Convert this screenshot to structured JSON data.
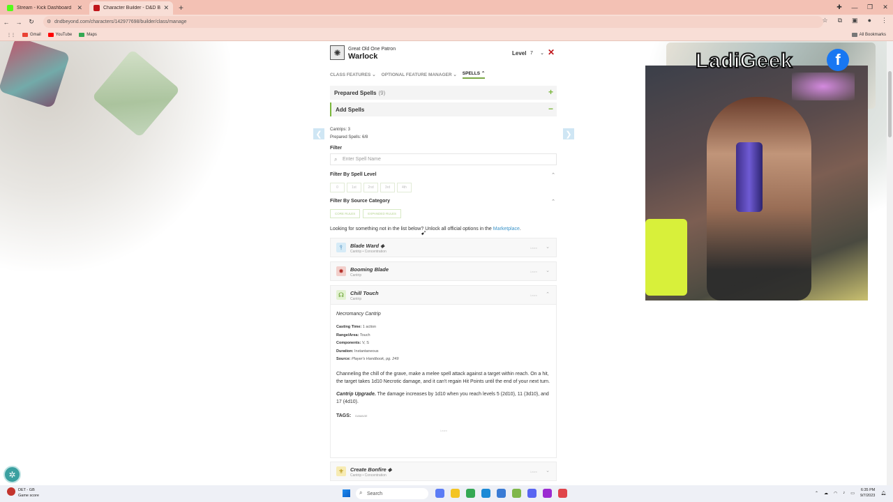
{
  "browser": {
    "tabs": [
      {
        "title": "Stream - Kick Dashboard",
        "favicon_color": "#53fc18",
        "active": false
      },
      {
        "title": "Character Builder - D&D Beyond",
        "favicon_color": "#c0161b",
        "active": true
      }
    ],
    "new_tab": "+",
    "url": "dndbeyond.com/characters/142977698/builder/class/manage",
    "bookmarks": [
      {
        "label": "Gmail",
        "color": "#ea4335"
      },
      {
        "label": "YouTube",
        "color": "#ff0000"
      },
      {
        "label": "Maps",
        "color": "#34a853"
      }
    ],
    "all_bookmarks": "All Bookmarks"
  },
  "builder": {
    "class_subtitle": "Great Old One Patron",
    "class_name": "Warlock",
    "level_label": "Level",
    "level_value": "7",
    "tabs": {
      "class_features": "CLASS FEATURES",
      "optional_feature_manager": "OPTIONAL FEATURE MANAGER",
      "spells": "SPELLS"
    },
    "prepared_spells": {
      "label": "Prepared Spells",
      "count": "(9)"
    },
    "add_spells": {
      "label": "Add Spells"
    },
    "cantrips": "Cantrips: 3",
    "prepared_count": "Prepared Spells: 6/8",
    "filter_label": "Filter",
    "search_placeholder": "Enter Spell Name",
    "filter_level_label": "Filter By Spell Level",
    "levels": [
      "0",
      "1st",
      "2nd",
      "3rd",
      "4th"
    ],
    "filter_source_label": "Filter By Source Category",
    "sources": [
      "CORE RULES",
      "EXPANDED RULES"
    ],
    "promo_text": "Looking for something not in the list below? Unlock all official options in the",
    "promo_link": "Marketplace",
    "promo_end": ".",
    "learn_label": "Learn",
    "spells": [
      {
        "name": "Blade Ward",
        "sub": "Cantrip • Concentration",
        "icon_color": "#5aa6d6"
      },
      {
        "name": "Booming Blade",
        "sub": "Cantrip",
        "icon_color": "#c9433b"
      },
      {
        "name": "Chill Touch",
        "sub": "Cantrip",
        "icon_color": "#7ab63b"
      }
    ],
    "detail": {
      "type": "Necromancy Cantrip",
      "casting_time_label": "Casting Time:",
      "casting_time": "1 action",
      "range_label": "Range/Area:",
      "range": "Touch",
      "components_label": "Components:",
      "components": "V, S",
      "duration_label": "Duration:",
      "duration": "Instantaneous",
      "source_label": "Source:",
      "source": "Player's Handbook, pg. 249",
      "description": "Channeling the chill of the grave, make a melee spell attack against a target within reach. On a hit, the target takes 1d10 Necrotic damage, and it can't regain Hit Points until the end of your next turn.",
      "upgrade_label": "Cantrip Upgrade.",
      "upgrade_text": "The damage increases by 1d10 when you reach levels 5 (2d10), 11 (3d10), and 17 (4d10).",
      "tags_label": "TAGS:",
      "tag": "DAMAGE"
    },
    "next_spell": {
      "name": "Create Bonfire",
      "sub": "Cantrip • Concentration",
      "icon_color": "#e0b70e"
    }
  },
  "overlay": {
    "title": "LadiGeek",
    "fb_glyph": "f"
  },
  "taskbar": {
    "weather_temp": "DET - GB",
    "weather_desc": "Game score",
    "search": "Search",
    "time": "6:35 PM",
    "date": "9/7/2023"
  }
}
